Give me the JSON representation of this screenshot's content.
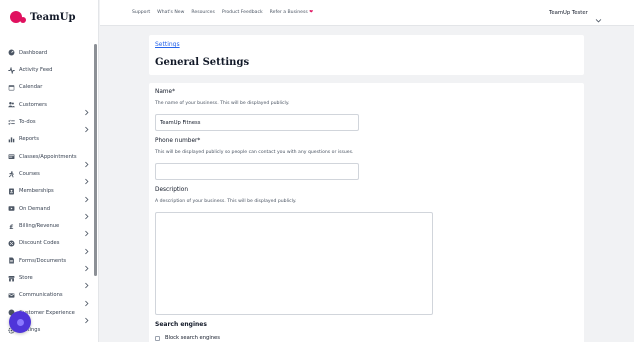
{
  "brand": {
    "name": "TeamUp",
    "color": "#e0115f"
  },
  "topbar": {
    "links": [
      "Support",
      "What's New",
      "Resources",
      "Product Feedback",
      "Refer a Business"
    ],
    "user_name": "TeamUp Tester",
    "user_icon": "chevron-down-icon"
  },
  "sidebar": {
    "items": [
      {
        "label": "Dashboard",
        "icon": "dashboard-icon",
        "has_chevron": false
      },
      {
        "label": "Activity Feed",
        "icon": "activity-icon",
        "has_chevron": false
      },
      {
        "label": "Calendar",
        "icon": "calendar-icon",
        "has_chevron": false
      },
      {
        "label": "Customers",
        "icon": "users-icon",
        "has_chevron": true
      },
      {
        "label": "To-dos",
        "icon": "checklist-icon",
        "has_chevron": true
      },
      {
        "label": "Reports",
        "icon": "reports-icon",
        "has_chevron": false
      },
      {
        "label": "Classes/Appointments",
        "icon": "classes-icon",
        "has_chevron": true
      },
      {
        "label": "Courses",
        "icon": "courses-icon",
        "has_chevron": true
      },
      {
        "label": "Memberships",
        "icon": "membership-icon",
        "has_chevron": true
      },
      {
        "label": "On Demand",
        "icon": "video-icon",
        "has_chevron": true
      },
      {
        "label": "Billing/Revenue",
        "icon": "pound-icon",
        "has_chevron": true
      },
      {
        "label": "Discount Codes",
        "icon": "discount-icon",
        "has_chevron": true
      },
      {
        "label": "Forms/Documents",
        "icon": "document-icon",
        "has_chevron": true
      },
      {
        "label": "Store",
        "icon": "store-icon",
        "has_chevron": true
      },
      {
        "label": "Communications",
        "icon": "mail-icon",
        "has_chevron": true
      },
      {
        "label": "Customer Experience",
        "icon": "experience-icon",
        "has_chevron": true
      },
      {
        "label": "Settings",
        "icon": "gear-icon",
        "has_chevron": false
      }
    ]
  },
  "page": {
    "breadcrumb": "Settings",
    "title": "General Settings"
  },
  "form": {
    "name": {
      "label": "Name*",
      "help": "The name of your business. This will be displayed publicly.",
      "value": "TeamUp Fitness"
    },
    "phone": {
      "label": "Phone number*",
      "help": "This will be displayed publicly so people can contact you with any questions or issues.",
      "value": ""
    },
    "description": {
      "label": "Description",
      "help": "A description of your business. This will be displayed publicly.",
      "value": ""
    },
    "search_engines": {
      "title": "Search engines",
      "checkbox_label": "Block search engines"
    }
  },
  "colors": {
    "accent": "#e0115f",
    "link": "#2563eb",
    "help_bubble": "#4f35d9",
    "background": "#f1f2f4"
  }
}
